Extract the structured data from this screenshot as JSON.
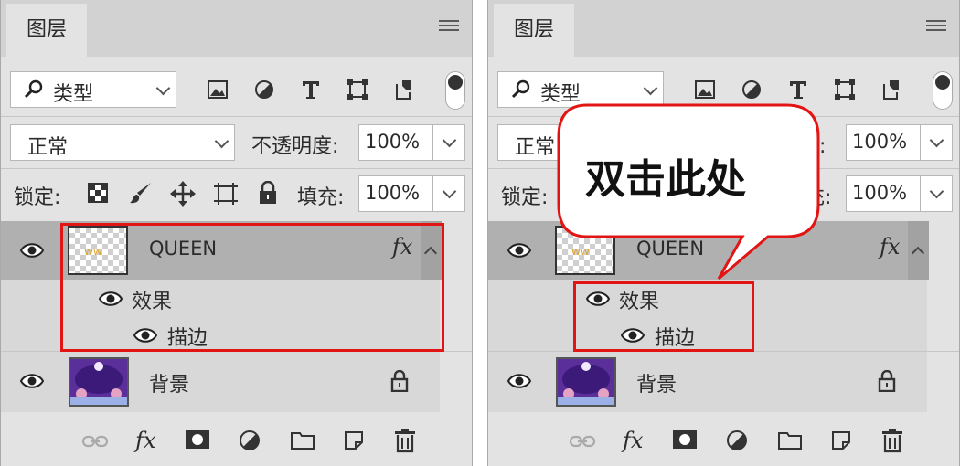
{
  "panel": {
    "tab": "图层",
    "filter": {
      "label": "类型"
    },
    "blend_mode": "正常",
    "opacity": {
      "label": "不透明度:",
      "value": "100%"
    },
    "lock": {
      "label": "锁定:"
    },
    "fill": {
      "label": "填充:",
      "value": "100%"
    }
  },
  "layers": [
    {
      "name": "QUEEN",
      "fx_label": "fx",
      "effects_label": "效果",
      "effect": "描边",
      "selected": true
    },
    {
      "name": "背景",
      "locked": true
    }
  ],
  "callout": {
    "text": "双击此处"
  },
  "colors": {
    "highlight": "#e21515",
    "selected_row": "#b0b0b0",
    "panel": "#e3e3e3"
  }
}
